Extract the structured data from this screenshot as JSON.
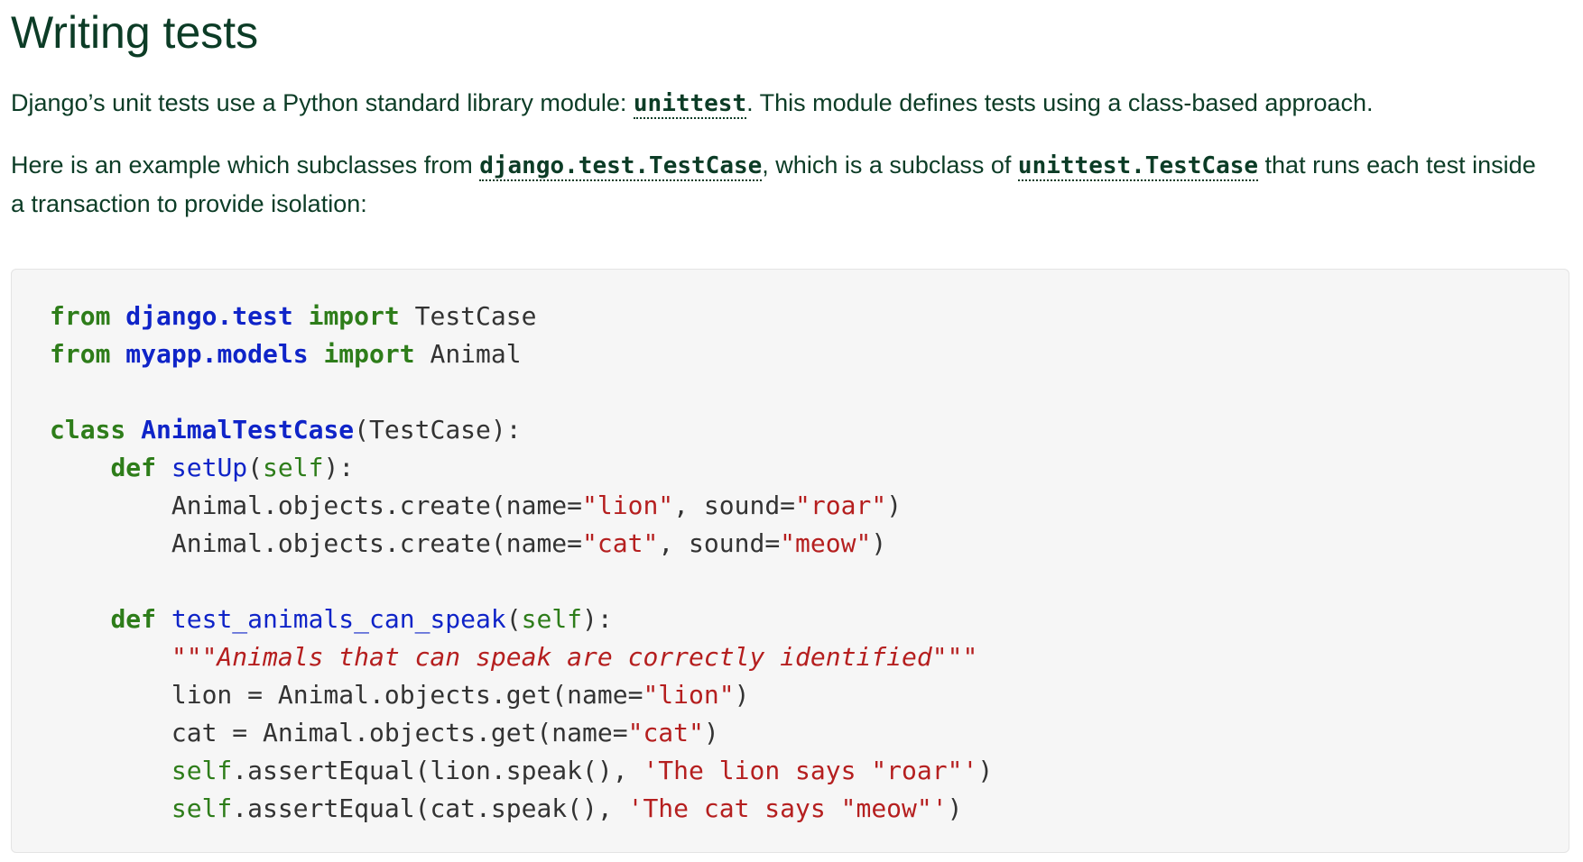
{
  "page": {
    "title": "Writing tests"
  },
  "intro": {
    "p1_before": "Django’s unit tests use a Python standard library module: ",
    "p1_link": "unittest",
    "p1_after": ". This module defines tests using a class-based approach.",
    "p2_before": "Here is an example which subclasses from ",
    "p2_link1": "django.test.TestCase",
    "p2_middle": ", which is a subclass of ",
    "p2_link2": "unittest.TestCase",
    "p2_after": " that runs each test inside a transaction to provide isolation:"
  },
  "code": {
    "l1_kw1": "from",
    "l1_mod": "django.test",
    "l1_kw2": "import",
    "l1_name": "TestCase",
    "l2_kw1": "from",
    "l2_mod": "myapp.models",
    "l2_kw2": "import",
    "l2_name": "Animal",
    "l4_kw": "class",
    "l4_cls": "AnimalTestCase",
    "l4_rest": "(TestCase):",
    "l5_kw": "def",
    "l5_fn": "setUp",
    "l5_p1": "(",
    "l5_self": "self",
    "l5_p2": "):",
    "l6_pre": "Animal.objects.create(name=",
    "l6_s1": "\"lion\"",
    "l6_mid": ", sound=",
    "l6_s2": "\"roar\"",
    "l6_end": ")",
    "l7_pre": "Animal.objects.create(name=",
    "l7_s1": "\"cat\"",
    "l7_mid": ", sound=",
    "l7_s2": "\"meow\"",
    "l7_end": ")",
    "l9_kw": "def",
    "l9_fn": "test_animals_can_speak",
    "l9_p1": "(",
    "l9_self": "self",
    "l9_p2": "):",
    "l10_doc": "\"\"\"Animals that can speak are correctly identified\"\"\"",
    "l11_pre": "lion = Animal.objects.get(name=",
    "l11_s": "\"lion\"",
    "l11_end": ")",
    "l12_pre": "cat = Animal.objects.get(name=",
    "l12_s": "\"cat\"",
    "l12_end": ")",
    "l13_self": "self",
    "l13_pre": ".assertEqual(lion.speak(), ",
    "l13_s": "'The lion says \"roar\"'",
    "l13_end": ")",
    "l14_self": "self",
    "l14_pre": ".assertEqual(cat.speak(), ",
    "l14_s": "'The cat says \"meow\"'",
    "l14_end": ")"
  },
  "colors": {
    "text": "#0c3c26",
    "keyword": "#2e7d1a",
    "name": "#0f24c8",
    "string": "#b51f1f",
    "code_background": "#f6f6f6"
  }
}
